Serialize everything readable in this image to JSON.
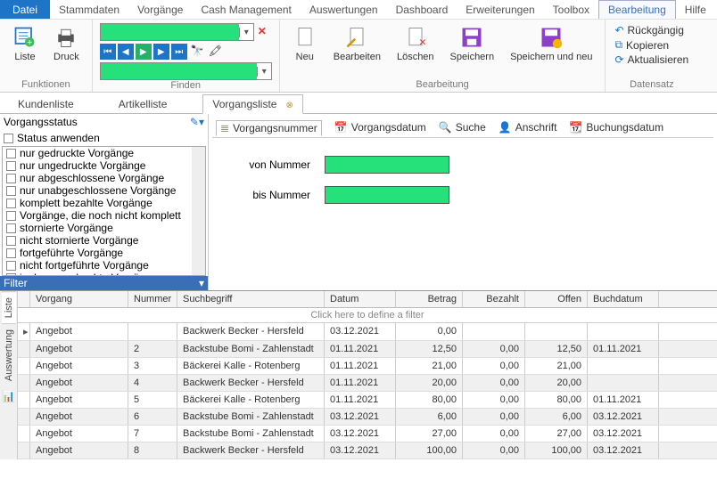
{
  "menu": [
    "Datei",
    "Stammdaten",
    "Vorgänge",
    "Cash Management",
    "Auswertungen",
    "Dashboard",
    "Erweiterungen",
    "Toolbox",
    "Bearbeitung",
    "Hilfe"
  ],
  "menu_active": 8,
  "ribbon": {
    "funktionen": {
      "label": "Funktionen",
      "liste": "Liste",
      "druck": "Druck"
    },
    "finden": {
      "label": "Finden"
    },
    "bearbeitung": {
      "label": "Bearbeitung",
      "neu": "Neu",
      "bearbeiten": "Bearbeiten",
      "loeschen": "Löschen",
      "speichern": "Speichern",
      "speichern_neu": "Speichern und neu"
    },
    "datensatz": {
      "label": "Datensatz",
      "rueck": "Rückgängig",
      "kopieren": "Kopieren",
      "aktualisieren": "Aktualisieren"
    }
  },
  "tabs": {
    "kundenliste": "Kundenliste",
    "artikelliste": "Artikelliste",
    "vorgangsliste": "Vorgangsliste"
  },
  "left": {
    "title": "Vorgangsstatus",
    "status_anwenden": "Status anwenden",
    "items": [
      "nur gedruckte Vorgänge",
      "nur ungedruckte Vorgänge",
      "nur abgeschlossene Vorgänge",
      "nur unabgeschlossene Vorgänge",
      "komplett bezahlte Vorgänge",
      "Vorgänge, die noch nicht komplett",
      "stornierte Vorgänge",
      "nicht stornierte Vorgänge",
      "fortgeführte Vorgänge",
      "nicht fortgeführte Vorgänge",
      "im Lager gebuchte Vorgänge"
    ],
    "filter": "Filter"
  },
  "subtabs": {
    "vorgangsnummer": "Vorgangsnummer",
    "vorgangsdatum": "Vorgangsdatum",
    "suche": "Suche",
    "anschrift": "Anschrift",
    "buchungsdatum": "Buchungsdatum"
  },
  "form": {
    "von": "von Nummer",
    "bis": "bis Nummer"
  },
  "grid": {
    "headers": {
      "vorgang": "Vorgang",
      "nummer": "Nummer",
      "such": "Suchbegriff",
      "datum": "Datum",
      "betrag": "Betrag",
      "bezahlt": "Bezahlt",
      "offen": "Offen",
      "buch": "Buchdatum"
    },
    "filter_hint": "Click here to define a filter",
    "rows": [
      {
        "vorgang": "Angebot",
        "nummer": "",
        "such": "Backwerk Becker - Hersfeld",
        "datum": "03.12.2021",
        "betrag": "0,00",
        "bezahlt": "",
        "offen": "",
        "buch": ""
      },
      {
        "vorgang": "Angebot",
        "nummer": "2",
        "such": "Backstube Bomi - Zahlenstadt",
        "datum": "01.11.2021",
        "betrag": "12,50",
        "bezahlt": "0,00",
        "offen": "12,50",
        "buch": "01.11.2021"
      },
      {
        "vorgang": "Angebot",
        "nummer": "3",
        "such": "Bäckerei Kalle - Rotenberg",
        "datum": "01.11.2021",
        "betrag": "21,00",
        "bezahlt": "0,00",
        "offen": "21,00",
        "buch": ""
      },
      {
        "vorgang": "Angebot",
        "nummer": "4",
        "such": "Backwerk Becker - Hersfeld",
        "datum": "01.11.2021",
        "betrag": "20,00",
        "bezahlt": "0,00",
        "offen": "20,00",
        "buch": ""
      },
      {
        "vorgang": "Angebot",
        "nummer": "5",
        "such": "Bäckerei Kalle - Rotenberg",
        "datum": "01.11.2021",
        "betrag": "80,00",
        "bezahlt": "0,00",
        "offen": "80,00",
        "buch": "01.11.2021"
      },
      {
        "vorgang": "Angebot",
        "nummer": "6",
        "such": "Backstube Bomi - Zahlenstadt",
        "datum": "03.12.2021",
        "betrag": "6,00",
        "bezahlt": "0,00",
        "offen": "6,00",
        "buch": "03.12.2021"
      },
      {
        "vorgang": "Angebot",
        "nummer": "7",
        "such": "Backstube Bomi - Zahlenstadt",
        "datum": "03.12.2021",
        "betrag": "27,00",
        "bezahlt": "0,00",
        "offen": "27,00",
        "buch": "03.12.2021"
      },
      {
        "vorgang": "Angebot",
        "nummer": "8",
        "such": "Backwerk Becker - Hersfeld",
        "datum": "03.12.2021",
        "betrag": "100,00",
        "bezahlt": "0,00",
        "offen": "100,00",
        "buch": "03.12.2021"
      }
    ]
  },
  "sidetabs": {
    "liste": "Liste",
    "auswertung": "Auswertung"
  }
}
